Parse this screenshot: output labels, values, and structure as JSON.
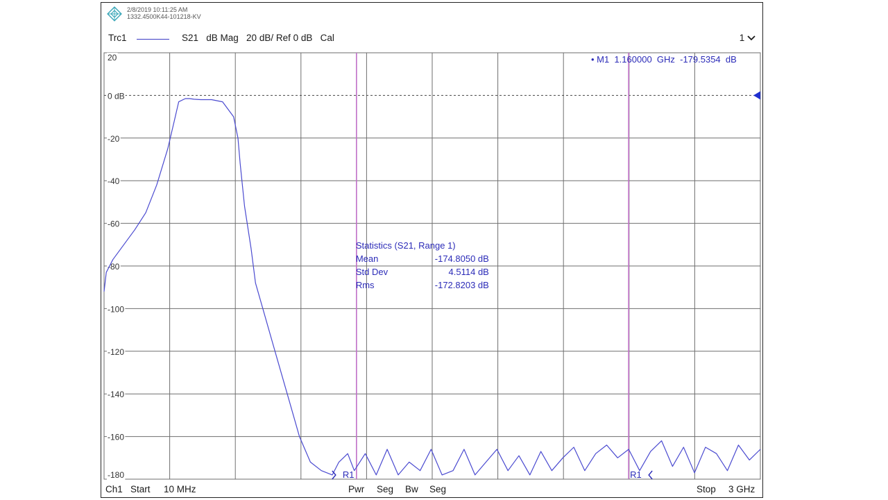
{
  "header": {
    "timestamp": "2/8/2019 10:11:25 AM",
    "instrument_id": "1332.4500K44-101218-KV",
    "trace_name": "Trc1",
    "trace_desc": "S21   dB Mag   20 dB/ Ref 0 dB   Cal",
    "channel_selector": "1"
  },
  "marker": {
    "label": "• M1  1.160000  GHz  -179.5354  dB",
    "freq_ghz": 1.16,
    "value_db": -179.5354
  },
  "statistics": {
    "title": "Statistics  (S21, Range 1)",
    "rows": [
      {
        "name": "Mean",
        "value": "-174.8050  dB"
      },
      {
        "name": "Std Dev",
        "value": "4.5114  dB"
      },
      {
        "name": "Rms",
        "value": "-172.8203  dB"
      }
    ]
  },
  "range_markers": {
    "left_label": "R1",
    "right_label": "R1"
  },
  "footer": {
    "channel": "Ch1",
    "start_label": "Start",
    "start_value": "10 MHz",
    "softkeys": [
      "Pwr",
      "Seg",
      "Bw",
      "Seg"
    ],
    "stop_label": "Stop",
    "stop_value": "3 GHz"
  },
  "colors": {
    "trace": "#4a4ad0",
    "grid": "#6e6e6e",
    "range_line": "#c070c8",
    "label_blue": "#2b2bb8",
    "ref_arrow": "#1f2fcf"
  },
  "chart_data": {
    "type": "line",
    "title": "",
    "xlabel": "",
    "ylabel": "",
    "x_unit": "GHz",
    "xlim": [
      0.01,
      3.0
    ],
    "ylim": [
      -180,
      20
    ],
    "y_ticks": [
      20,
      0,
      -20,
      -40,
      -60,
      -80,
      -100,
      -120,
      -140,
      -160,
      -180
    ],
    "y_tick_labels": [
      "20",
      "0 dB",
      "-20",
      "-40",
      "-60",
      "-80",
      "-100",
      "-120",
      "-140",
      "-160",
      "-180"
    ],
    "x_divisions": 10,
    "reference_db": 0,
    "range_1_ghz": [
      1.16,
      2.4
    ],
    "series": [
      {
        "x": [
          0.01,
          0.02,
          0.05,
          0.1,
          0.15,
          0.2,
          0.25,
          0.3,
          0.33,
          0.35,
          0.38,
          0.4,
          0.42,
          0.45,
          0.5,
          0.55,
          0.6,
          0.62,
          0.63,
          0.65,
          0.68,
          0.7,
          0.75,
          0.8,
          0.85,
          0.9,
          0.95,
          1.0,
          1.05,
          1.08,
          1.1,
          1.12,
          1.15,
          1.2,
          1.25,
          1.3,
          1.35,
          1.4,
          1.45,
          1.5,
          1.55,
          1.6,
          1.65,
          1.7,
          1.75,
          1.8,
          1.85,
          1.9,
          1.95,
          2.0,
          2.05,
          2.1,
          2.15,
          2.2,
          2.25,
          2.3,
          2.35,
          2.4,
          2.45,
          2.5,
          2.55,
          2.6,
          2.65,
          2.7,
          2.75,
          2.8,
          2.85,
          2.9,
          2.95,
          3.0
        ],
        "y": [
          -92,
          -83,
          -77,
          -70,
          -63,
          -55,
          -42,
          -25,
          -12,
          -3,
          -1.5,
          -1.5,
          -1.8,
          -2,
          -2,
          -3,
          -10,
          -20,
          -32,
          -52,
          -72,
          -88,
          -106,
          -124,
          -142,
          -160,
          -172,
          -176,
          -178,
          -172,
          -170,
          -168,
          -176,
          -168,
          -178,
          -166,
          -178,
          -172,
          -176,
          -166,
          -178,
          -176,
          -166,
          -178,
          -172,
          -166,
          -176,
          -169,
          -178,
          -167,
          -176,
          -170,
          -165,
          -176,
          -168,
          -164,
          -170,
          -166,
          -176,
          -167,
          -162,
          -174,
          -165,
          -177,
          -165,
          -168,
          -176,
          -164,
          -171,
          -166
        ]
      }
    ]
  }
}
